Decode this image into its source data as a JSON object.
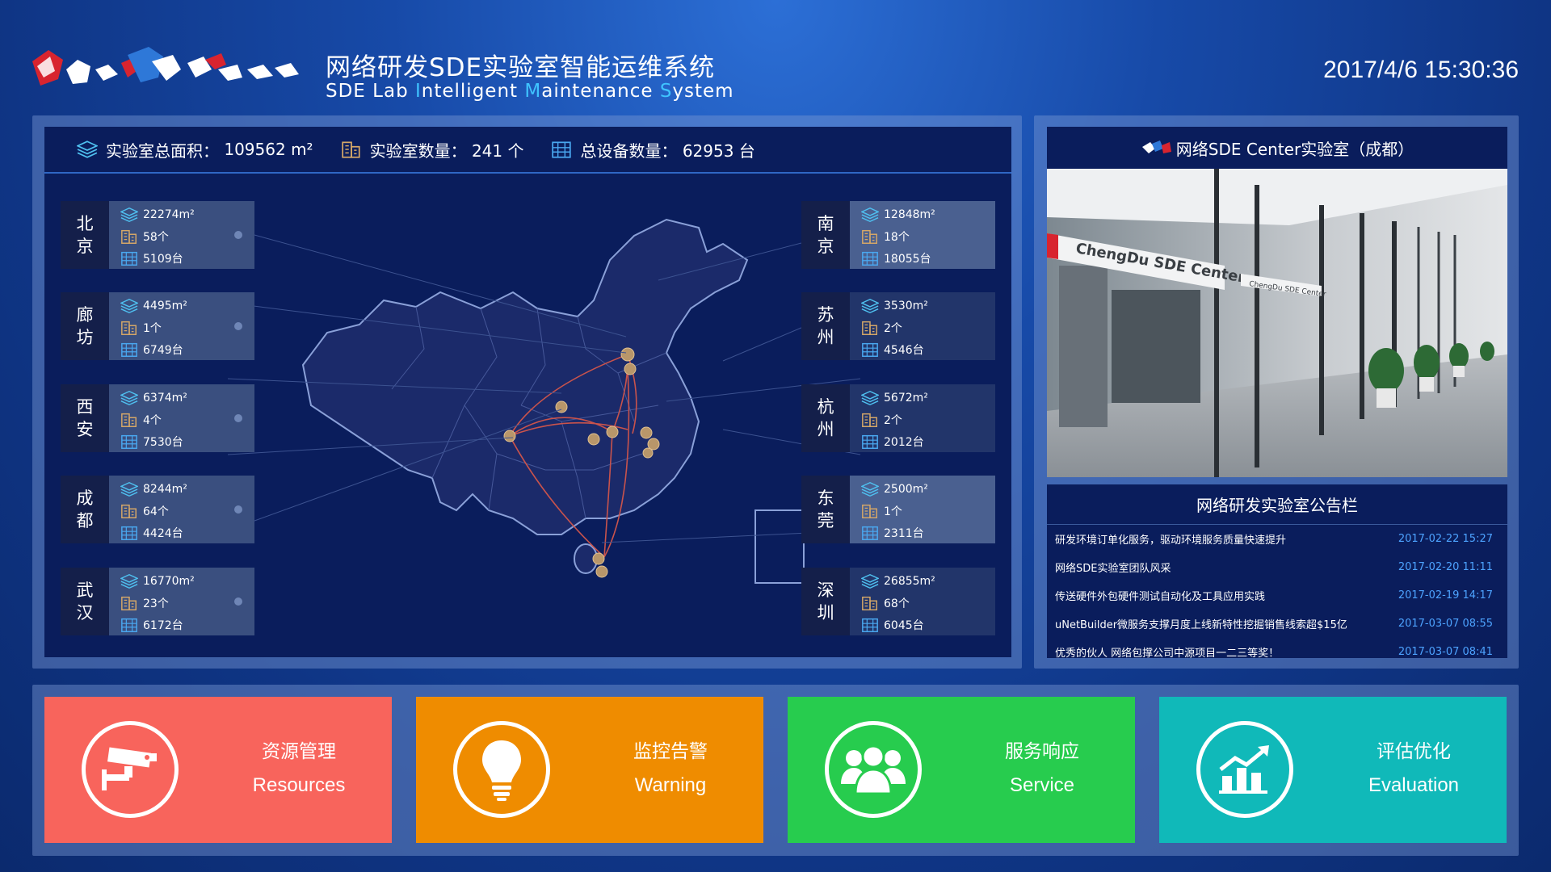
{
  "header": {
    "title_cn": "网络研发SDE实验室智能运维系统",
    "title_en_parts": [
      {
        "cap": "",
        "rest": "SDE  "
      },
      {
        "cap": "",
        "rest": "Lab  "
      },
      {
        "cap": "I",
        "rest": "ntelligent  "
      },
      {
        "cap": "M",
        "rest": "aintenance  "
      },
      {
        "cap": "S",
        "rest": "ystem"
      }
    ],
    "datetime": "2017/4/6 15:30:36",
    "accent_color": "#3fc3ff"
  },
  "stats": {
    "area_label": "实验室总面积：",
    "area_value": "109562 m²",
    "labs_label": "实验室数量：",
    "labs_value": "241 个",
    "devices_label": "总设备数量：",
    "devices_value": "62953 台"
  },
  "cities_left": [
    {
      "c1": "北",
      "c2": "京",
      "area": "22274m²",
      "labs": "58个",
      "devices": "5109台"
    },
    {
      "c1": "廊",
      "c2": "坊",
      "area": "4495m²",
      "labs": "1个",
      "devices": "6749台"
    },
    {
      "c1": "西",
      "c2": "安",
      "area": "6374m²",
      "labs": "4个",
      "devices": "7530台"
    },
    {
      "c1": "成",
      "c2": "都",
      "area": "8244m²",
      "labs": "64个",
      "devices": "4424台"
    },
    {
      "c1": "武",
      "c2": "汉",
      "area": "16770m²",
      "labs": "23个",
      "devices": "6172台"
    }
  ],
  "cities_right": [
    {
      "c1": "南",
      "c2": "京",
      "area": "12848m²",
      "labs": "18个",
      "devices": "18055台"
    },
    {
      "c1": "苏",
      "c2": "州",
      "area": "3530m²",
      "labs": "2个",
      "devices": "4546台"
    },
    {
      "c1": "杭",
      "c2": "州",
      "area": "5672m²",
      "labs": "2个",
      "devices": "2012台"
    },
    {
      "c1": "东",
      "c2": "莞",
      "area": "2500m²",
      "labs": "1个",
      "devices": "2311台"
    },
    {
      "c1": "深",
      "c2": "圳",
      "area": "26855m²",
      "labs": "68个",
      "devices": "6045台"
    }
  ],
  "lab": {
    "title": "网络SDE Center实验室（成都）",
    "sign_text": "ChengDu SDE Center",
    "sign_text_small": "ChengDu SDE Center"
  },
  "notice": {
    "title": "网络研发实验室公告栏",
    "items": [
      {
        "text": "研发环境订单化服务，驱动环境服务质量快速提升",
        "date": "2017-02-22 15:27"
      },
      {
        "text": "网络SDE实验室团队风采",
        "date": "2017-02-20 11:11"
      },
      {
        "text": "传送硬件外包硬件测试自动化及工具应用实践",
        "date": "2017-02-19 14:17"
      },
      {
        "text": "uNetBuilder微服务支撑月度上线新特性挖掘销售线索超$15亿",
        "date": "2017-03-07 08:55"
      },
      {
        "text": "优秀的伙人 网络包撑公司中源项目一二三等奖！",
        "date": "2017-03-07 08:41"
      }
    ]
  },
  "tiles": [
    {
      "cn": "资源管理",
      "en": "Resources",
      "color": "#f8645c",
      "icon": "camera-icon"
    },
    {
      "cn": "监控告警",
      "en": "Warning",
      "color": "#ef8c00",
      "icon": "lightbulb-icon"
    },
    {
      "cn": "服务响应",
      "en": "Service",
      "color": "#27cc4e",
      "icon": "users-icon"
    },
    {
      "cn": "评估优化",
      "en": "Evaluation",
      "color": "#10b9b9",
      "icon": "chart-icon"
    }
  ]
}
